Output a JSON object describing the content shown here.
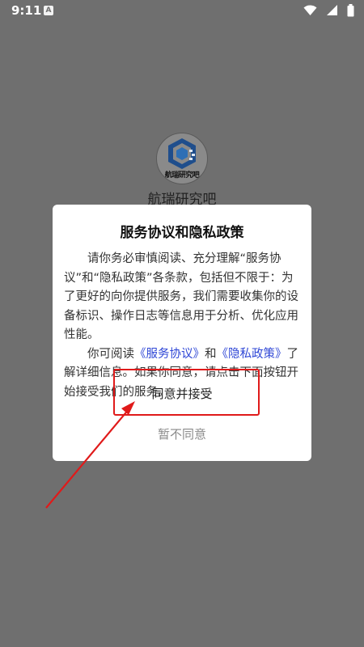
{
  "status_bar": {
    "time": "9:11",
    "notification_glyph": "A",
    "icons": [
      "wifi-icon",
      "signal-icon",
      "battery-icon"
    ]
  },
  "app": {
    "logo_icon": "app-logo-icon",
    "logo_text": "航瑞研究吧",
    "name": "航瑞研究吧"
  },
  "dialog": {
    "title": "服务协议和隐私政策",
    "paragraph1": "请你务必审慎阅读、充分理解“服务协议”和“隐私政策”各条款，包括但不限于：为了更好的向你提供服务，我们需要收集你的设备标识、操作日志等信息用于分析、优化应用性能。",
    "p2_prefix": "你可阅读",
    "service_agreement_link": "《服务协议》",
    "p2_and": "和",
    "privacy_policy_link": "《隐私政策》",
    "p2_suffix": "了解详细信息。如果你同意，请点击下面按钮开始接受我们的服务。",
    "accept_label": "同意并接受",
    "decline_label": "暂不同意",
    "link_color": "#2f47d6"
  },
  "annotation": {
    "highlight_color": "#e01a1a"
  }
}
